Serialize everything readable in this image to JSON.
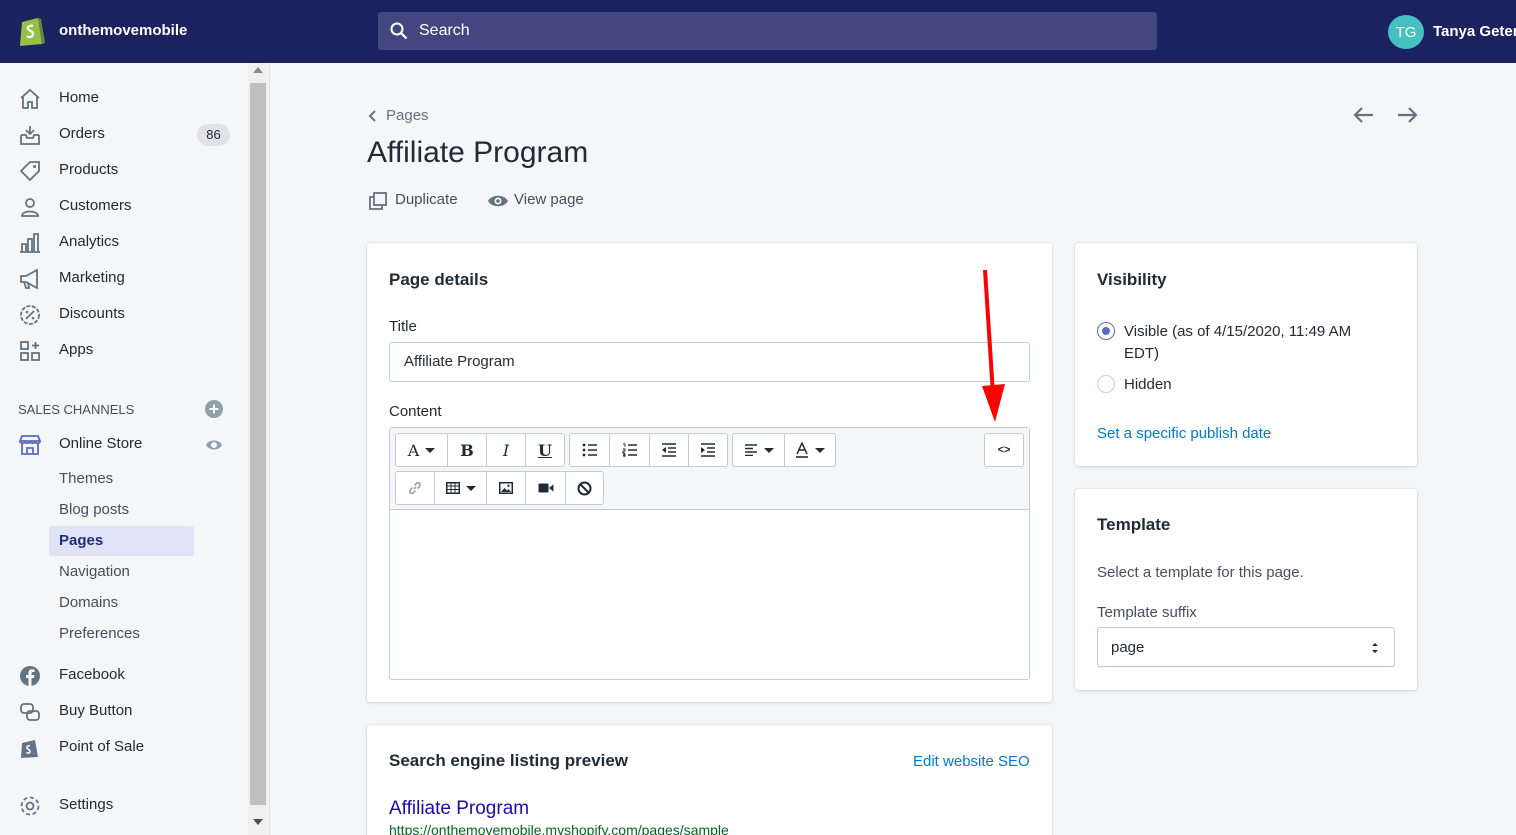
{
  "topbar": {
    "store_name": "onthemovemobile",
    "search_placeholder": "Search",
    "avatar_initials": "TG",
    "user_name": "Tanya Geter"
  },
  "sidebar": {
    "items": [
      {
        "label": "Home",
        "icon": "home-icon"
      },
      {
        "label": "Orders",
        "icon": "orders-icon",
        "badge": "86"
      },
      {
        "label": "Products",
        "icon": "tag-icon"
      },
      {
        "label": "Customers",
        "icon": "person-icon"
      },
      {
        "label": "Analytics",
        "icon": "bar-chart-icon"
      },
      {
        "label": "Marketing",
        "icon": "megaphone-icon"
      },
      {
        "label": "Discounts",
        "icon": "discount-icon"
      },
      {
        "label": "Apps",
        "icon": "apps-icon"
      }
    ],
    "sales_channels_title": "SALES CHANNELS",
    "online_store": "Online Store",
    "online_store_sub": [
      "Themes",
      "Blog posts",
      "Pages",
      "Navigation",
      "Domains",
      "Preferences"
    ],
    "active_sub": "Pages",
    "channels": [
      "Facebook",
      "Buy Button",
      "Point of Sale"
    ],
    "settings": "Settings"
  },
  "main": {
    "breadcrumb": "Pages",
    "title": "Affiliate Program",
    "actions": {
      "duplicate": "Duplicate",
      "view_page": "View page"
    },
    "page_details": {
      "card_title": "Page details",
      "title_label": "Title",
      "title_value": "Affiliate Program",
      "content_label": "Content",
      "html_toggle": "<>"
    },
    "seo": {
      "card_title": "Search engine listing preview",
      "edit_link": "Edit website SEO",
      "preview_title": "Affiliate Program",
      "preview_url": "https://onthemovemobile.myshopify.com/pages/sample"
    },
    "visibility": {
      "card_title": "Visibility",
      "visible_label": "Visible (as of 4/15/2020, 11:49 AM",
      "visible_label_2": "EDT)",
      "hidden_label": "Hidden",
      "publish_link": "Set a specific publish date",
      "selected": "visible"
    },
    "template": {
      "card_title": "Template",
      "description": "Select a template for this page.",
      "suffix_label": "Template suffix",
      "suffix_value": "page"
    }
  },
  "colors": {
    "topbar": "#1c2260",
    "accent": "#5c6ac4",
    "link": "#007ace",
    "annotation_arrow": "#ff0000"
  }
}
